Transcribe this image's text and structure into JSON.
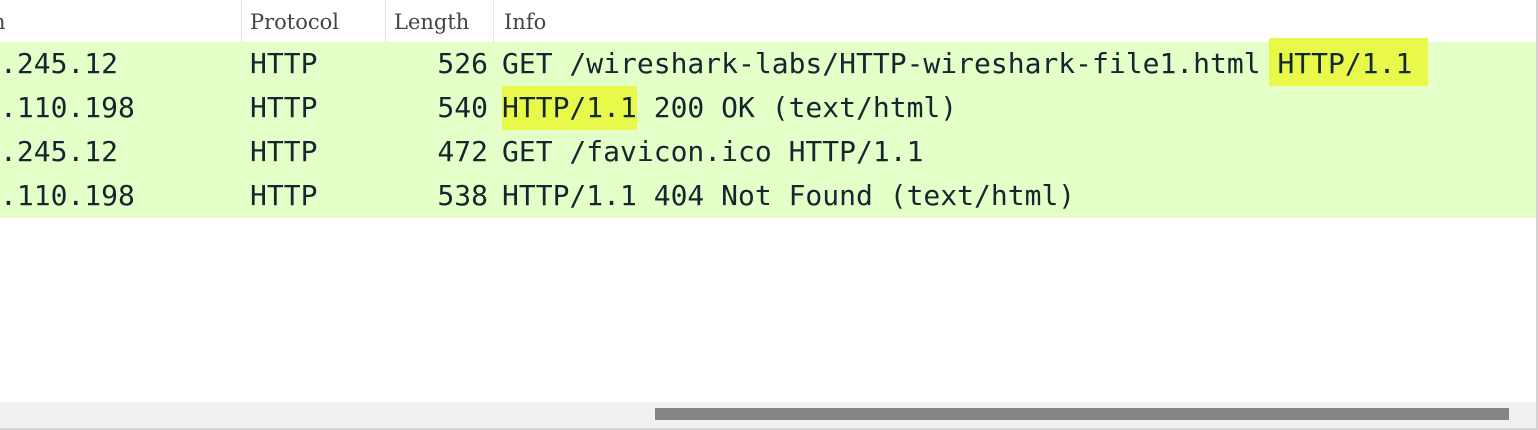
{
  "columns": {
    "destination": "n",
    "protocol": "Protocol",
    "length": "Length",
    "info": "Info"
  },
  "packets": [
    {
      "destination": ".245.12",
      "protocol": "HTTP",
      "length": "526",
      "info_before": "GET /wireshark-labs/HTTP-wireshark-file1.html ",
      "info_highlight": "HTTP/1.1",
      "info_after": ""
    },
    {
      "destination": ".110.198",
      "protocol": "HTTP",
      "length": "540",
      "info_before": "",
      "info_highlight": "HTTP/1.1",
      "info_after": " 200 OK  (text/html)"
    },
    {
      "destination": ".245.12",
      "protocol": "HTTP",
      "length": "472",
      "info_before": "GET /favicon.ico HTTP/1.1",
      "info_highlight": "",
      "info_after": ""
    },
    {
      "destination": ".110.198",
      "protocol": "HTTP",
      "length": "538",
      "info_before": "HTTP/1.1 404 Not Found  (text/html)",
      "info_highlight": "",
      "info_after": ""
    }
  ],
  "colors": {
    "row_background": "#e4ffc7",
    "highlight": "#e8f94a",
    "text": "#12272e"
  }
}
